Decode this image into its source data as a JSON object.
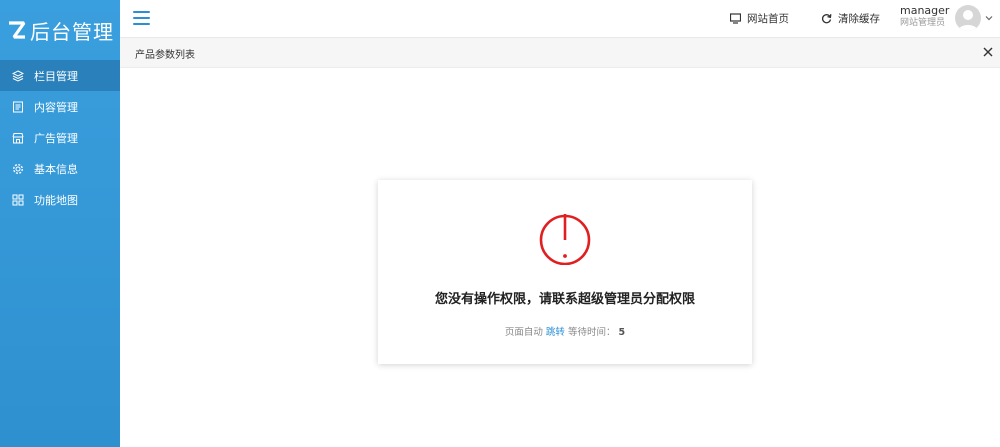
{
  "app": {
    "logo_text": "后台管理",
    "brand_color": "#2f90cf"
  },
  "sidebar": {
    "items": [
      {
        "label": "栏目管理",
        "icon": "layers-icon",
        "active": true
      },
      {
        "label": "内容管理",
        "icon": "document-icon",
        "active": false
      },
      {
        "label": "广告管理",
        "icon": "shop-icon",
        "active": false
      },
      {
        "label": "基本信息",
        "icon": "gear-icon",
        "active": false
      },
      {
        "label": "功能地图",
        "icon": "grid-icon",
        "active": false
      }
    ]
  },
  "header": {
    "site_home": "网站首页",
    "clear_cache": "清除缓存",
    "user_name": "manager",
    "user_role": "网站管理员"
  },
  "tabs": [
    {
      "label": "产品参数列表"
    }
  ],
  "notice": {
    "message": "您没有操作权限，请联系超级管理员分配权限",
    "auto_prefix": "页面自动",
    "jump_label": "跳转",
    "wait_label": "等待时间：",
    "seconds": "5",
    "icon_color": "#e02020"
  }
}
